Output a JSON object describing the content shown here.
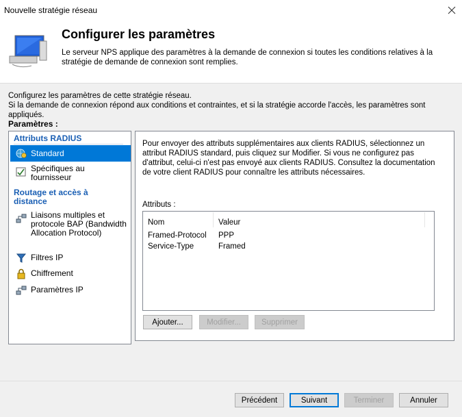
{
  "window": {
    "title": "Nouvelle stratégie réseau"
  },
  "header": {
    "title": "Configurer les paramètres",
    "description": "Le serveur NPS applique des paramètres à la demande de connexion si toutes les conditions relatives à la stratégie de demande de connexion sont remplies."
  },
  "intro": {
    "line1": "Configurez les paramètres de cette stratégie réseau.",
    "line2": "Si la demande de connexion répond aux conditions et contraintes, et si la stratégie accorde l'accès, les paramètres sont appliqués."
  },
  "params_label": "Paramètres :",
  "nav": {
    "section1": "Attributs RADIUS",
    "items1": [
      {
        "label": "Standard",
        "icon": "gear-globe-icon",
        "selected": true
      },
      {
        "label": "Spécifiques au fournisseur",
        "icon": "checklist-icon",
        "selected": false
      }
    ],
    "section2": "Routage et accès à distance",
    "items2": [
      {
        "label": "Liaisons multiples et protocole BAP (Bandwidth Allocation Protocol)",
        "icon": "network-links-icon"
      },
      {
        "label": "Filtres IP",
        "icon": "filter-icon"
      },
      {
        "label": "Chiffrement",
        "icon": "lock-icon"
      },
      {
        "label": "Paramètres IP",
        "icon": "network-settings-icon"
      }
    ]
  },
  "panel": {
    "description": "Pour envoyer des attributs supplémentaires aux clients RADIUS, sélectionnez un attribut RADIUS standard, puis cliquez sur Modifier. Si vous ne configurez pas d'attribut, celui-ci n'est pas envoyé aux clients RADIUS. Consultez la documentation de votre client RADIUS pour connaître les attributs nécessaires.",
    "attributes_label": "Attributs :",
    "columns": [
      "Nom",
      "Valeur"
    ],
    "rows": [
      [
        "Framed-Protocol",
        "PPP"
      ],
      [
        "Service-Type",
        "Framed"
      ]
    ],
    "buttons": {
      "add": "Ajouter...",
      "edit": "Modifier...",
      "delete": "Supprimer"
    }
  },
  "footer": {
    "previous": "Précédent",
    "next": "Suivant",
    "finish": "Terminer",
    "cancel": "Annuler"
  },
  "colors": {
    "selection": "#0078d7",
    "section": "#1a5fb4"
  }
}
